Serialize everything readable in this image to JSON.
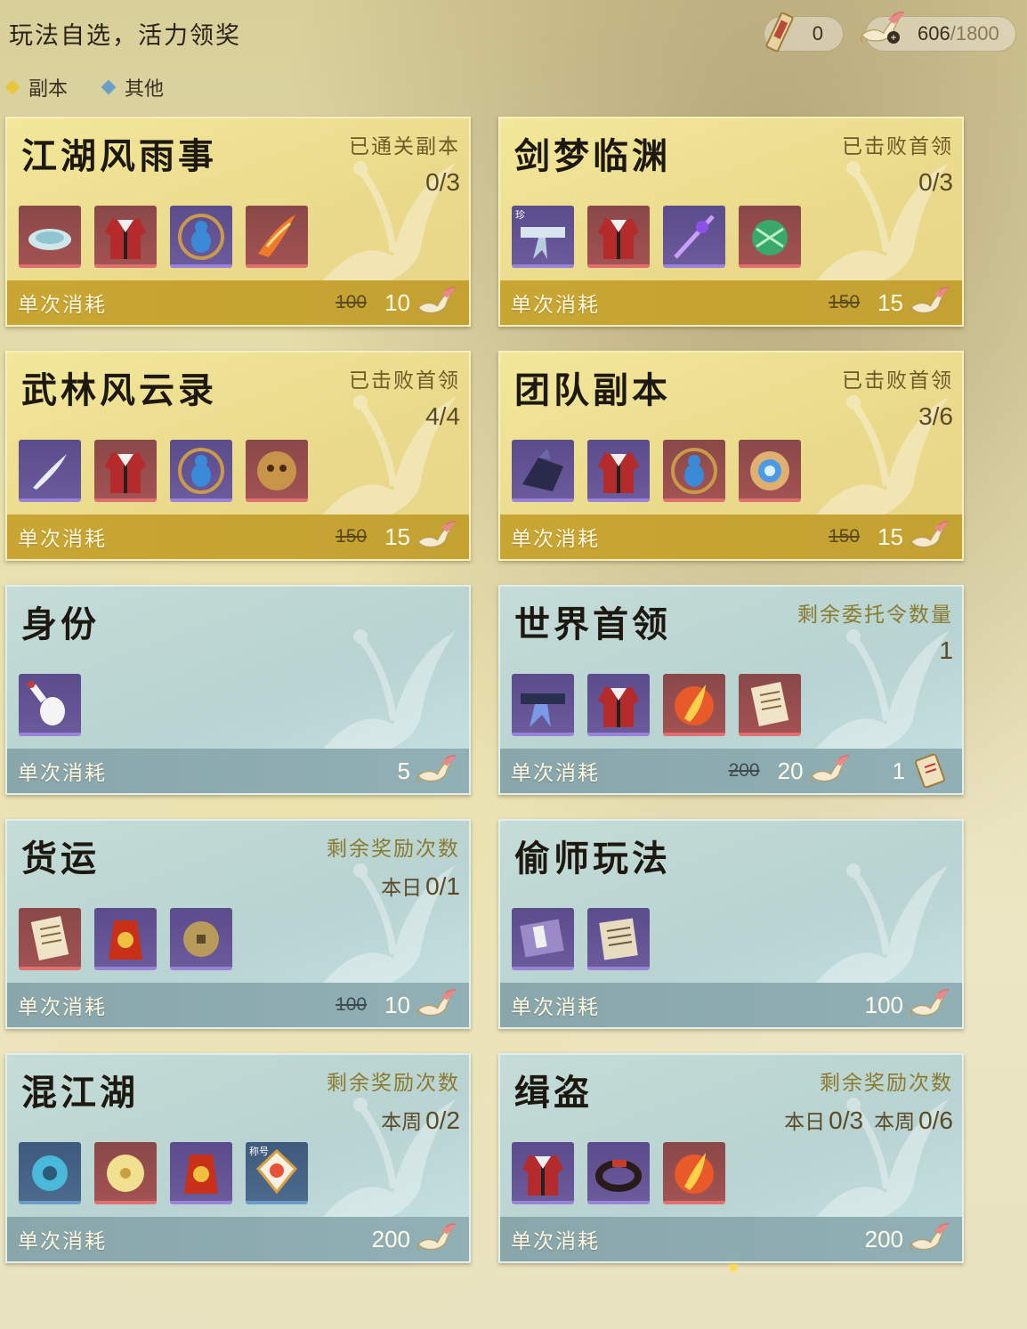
{
  "header": {
    "title": "玩法自选，活力领奖",
    "token_count": "0",
    "energy_current": "606",
    "energy_max": "/1800"
  },
  "legend": [
    {
      "label": "副本",
      "color": "#e8c83a"
    },
    {
      "label": "其他",
      "color": "#6aa0c8"
    }
  ],
  "cards": [
    {
      "title": "江湖风雨事",
      "status": "已通关副本",
      "progress": "0/3",
      "cost_label": "单次消耗",
      "cost_old": "100",
      "cost": "10",
      "items": [
        "jade-plate-icon",
        "red-robe-icon",
        "gourd-amulet-icon",
        "flame-blade-icon"
      ]
    },
    {
      "title": "剑梦临渊",
      "status": "已击败首领",
      "progress": "0/3",
      "cost_label": "单次消耗",
      "cost_old": "150",
      "cost": "15",
      "item_badge": "珍",
      "items": [
        "silk-belt-icon",
        "red-robe-icon",
        "purple-sword-icon",
        "green-spirit-icon"
      ]
    },
    {
      "title": "武林风云录",
      "status": "已击败首领",
      "progress": "4/4",
      "cost_label": "单次消耗",
      "cost_old": "150",
      "cost": "15",
      "items": [
        "feather-blade-icon",
        "red-robe-icon",
        "gourd-amulet-icon",
        "golden-mask-icon"
      ]
    },
    {
      "title": "团队副本",
      "status": "已击败首领",
      "progress": "3/6",
      "cost_label": "单次消耗",
      "cost_old": "150",
      "cost": "15",
      "items": [
        "dragon-gauntlet-icon",
        "red-robe-icon",
        "gourd-amulet-icon",
        "blue-orb-icon"
      ]
    },
    {
      "title": "身份",
      "cost_label": "单次消耗",
      "cost": "5",
      "items": [
        "white-vase-icon"
      ]
    },
    {
      "title": "世界首领",
      "status": "剩余委托令数量",
      "progress": "1",
      "cost_label": "单次消耗",
      "cost_old": "200",
      "cost": "20",
      "extra_cost": "1",
      "items": [
        "blue-sash-icon",
        "red-robe-icon",
        "phoenix-flame-icon",
        "paper-note-icon"
      ]
    },
    {
      "title": "货运",
      "status": "剩余奖励次数",
      "progress_prefix": "本日",
      "progress": "0/1",
      "cost_label": "单次消耗",
      "cost_old": "100",
      "cost": "10",
      "items": [
        "paper-note-icon",
        "red-pouch-icon",
        "coin-icon"
      ]
    },
    {
      "title": "偷师玩法",
      "cost_label": "单次消耗",
      "cost": "100",
      "items": [
        "manual-book-icon",
        "scroll-paper-icon"
      ]
    },
    {
      "title": "混江湖",
      "status": "剩余奖励次数",
      "progress_prefix": "本周",
      "progress": "0/2",
      "cost_label": "单次消耗",
      "cost": "200",
      "item_badge": "称号",
      "items": [
        "jade-ring-icon",
        "gold-disc-icon",
        "red-pouch-icon",
        "title-tag-icon"
      ]
    },
    {
      "title": "缉盗",
      "status": "剩余奖励次数",
      "progress_prefix": "本日",
      "progress": "0/3",
      "progress_prefix2": "本周",
      "progress2": "0/6",
      "cost_label": "单次消耗",
      "cost": "200",
      "items": [
        "red-robe-icon",
        "red-bracelet-icon",
        "phoenix-flame-icon"
      ]
    }
  ]
}
